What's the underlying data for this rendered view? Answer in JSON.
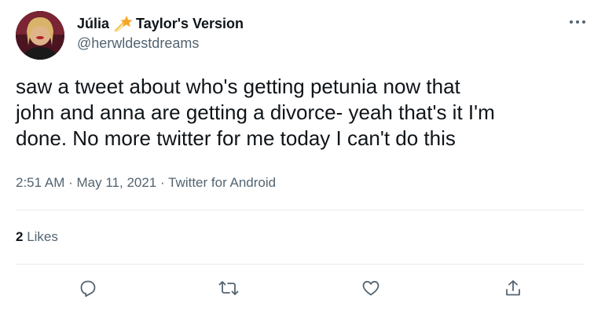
{
  "author": {
    "name_prefix": "Júlia",
    "name_suffix": "Taylor's Version",
    "handle": "@herwldestdreams",
    "star_icon": "shooting-star-emoji"
  },
  "tweet": {
    "text": "saw a tweet about who's getting petunia now that\njohn and anna are getting a divorce- yeah that's it I'm\ndone. No more twitter for me today I can't do this"
  },
  "meta": {
    "time": "2:51 AM",
    "separator": "·",
    "date": "May 11, 2021",
    "source": "Twitter for Android"
  },
  "stats": {
    "likes_count": "2",
    "likes_label": "Likes"
  },
  "actions": {
    "icons": [
      "reply-icon",
      "retweet-icon",
      "like-icon",
      "share-icon"
    ]
  },
  "colors": {
    "text": "#0f1419",
    "secondary": "#536471",
    "divider": "#e6ecf0",
    "star": "#f5a623"
  }
}
